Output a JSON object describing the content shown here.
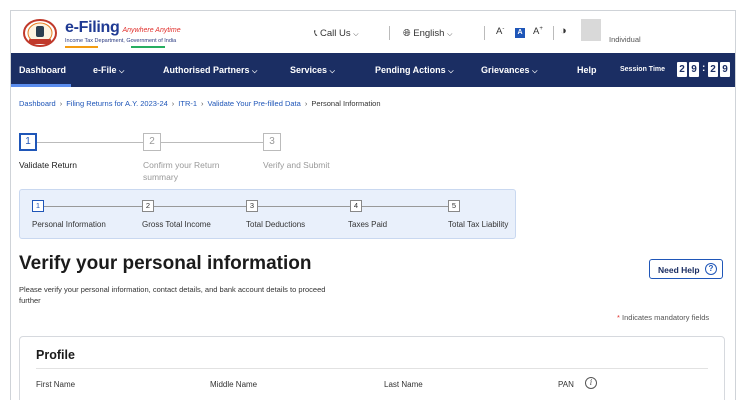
{
  "header": {
    "brand_title": "e-Filing",
    "brand_tagline": "Anywhere Anytime",
    "brand_subtitle": "Income Tax Department, Government of India",
    "call_us": "Call Us",
    "language": "English",
    "font_decrease": "A",
    "font_normal": "A",
    "font_increase": "A",
    "contrast": "◑",
    "user_role": "Individual"
  },
  "nav": {
    "items": [
      "Dashboard",
      "e-File",
      "Authorised Partners",
      "Services",
      "Pending Actions",
      "Grievances",
      "Help"
    ],
    "session_label": "Session Time",
    "session_digits": [
      "2",
      "9",
      "2",
      "9"
    ]
  },
  "breadcrumb": {
    "items": [
      "Dashboard",
      "Filing Returns for A.Y. 2023-24",
      "ITR-1",
      "Validate Your Pre-filled Data",
      "Personal Information"
    ]
  },
  "main_steps": [
    {
      "num": "1",
      "label": "Validate Return"
    },
    {
      "num": "2",
      "label": "Confirm your Return summary"
    },
    {
      "num": "3",
      "label": "Verify and Submit"
    }
  ],
  "sub_steps": [
    {
      "num": "1",
      "label": "Personal Information"
    },
    {
      "num": "2",
      "label": "Gross Total Income"
    },
    {
      "num": "3",
      "label": "Total Deductions"
    },
    {
      "num": "4",
      "label": "Taxes Paid"
    },
    {
      "num": "5",
      "label": "Total Tax Liability"
    }
  ],
  "content": {
    "title": "Verify your personal information",
    "need_help": "Need Help",
    "description": "Please verify your personal information, contact details, and bank account details to proceed further",
    "mandatory_star": "*",
    "mandatory_text": "Indicates mandatory fields"
  },
  "profile": {
    "title": "Profile",
    "fields": [
      "First Name",
      "Middle Name",
      "Last Name",
      "PAN"
    ]
  },
  "colors": {
    "nav_bg": "#1b2e63",
    "accent": "#1f56b8",
    "panel_bg": "#e9f0fb"
  }
}
